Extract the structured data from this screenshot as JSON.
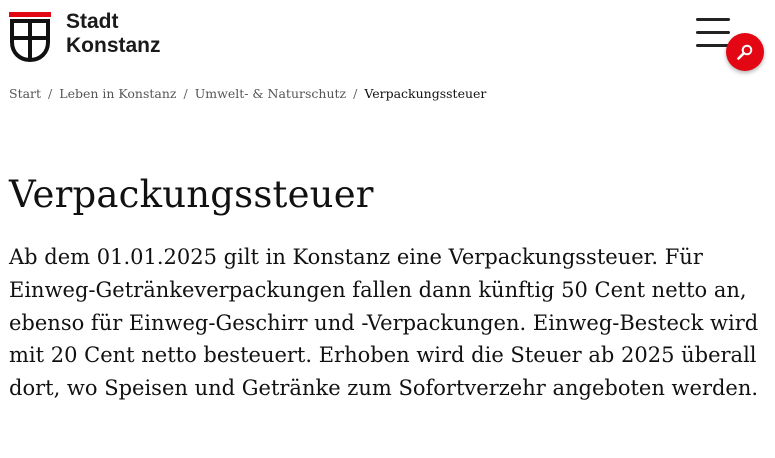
{
  "header": {
    "logo_line1": "Stadt",
    "logo_line2": "Konstanz",
    "menu_icon": "hamburger-menu-icon",
    "search_icon": "search-icon",
    "accent_color": "#e30613"
  },
  "breadcrumb": {
    "items": [
      "Start",
      "Leben in Konstanz",
      "Umwelt- & Naturschutz"
    ],
    "current": "Verpackungssteuer",
    "separator": "/"
  },
  "main": {
    "title": "Verpackungssteuer",
    "intro": "Ab dem 01.01.2025 gilt in Konstanz eine Verpackungssteuer. Für Einweg-Getränkeverpackungen fallen dann künftig 50 Cent netto an, ebenso für Einweg-Geschirr und -Verpackungen. Einweg-Besteck wird mit 20 Cent netto besteuert. Erhoben wird die Steuer ab 2025 überall dort, wo Speisen und Getränke zum Sofortverzehr angeboten werden."
  }
}
